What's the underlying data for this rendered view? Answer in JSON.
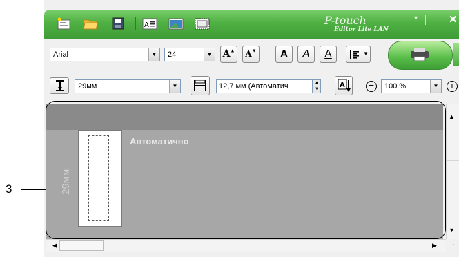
{
  "titlebar": {
    "brand_line1": "P-touch",
    "brand_line2": "Editor Lite LAN",
    "menu_arrow": "▾",
    "minimize": "–",
    "close": "✕"
  },
  "toolbar1": {
    "font_name": "Arial",
    "font_size": "24",
    "grow_font": "A",
    "shrink_font": "A",
    "bold": "A",
    "italic": "A",
    "underline": "A"
  },
  "toolbar2": {
    "tape_width": "29мм",
    "label_length": "12,7 мм (Автоматич",
    "zoom": "100 %",
    "zoom_out": "−",
    "zoom_in": "+"
  },
  "canvas": {
    "tape_label": "29мм",
    "length_text": "Автоматично"
  },
  "callout": {
    "number": "3"
  },
  "colors": {
    "titlebar_green": "#4fb043",
    "canvas_gray": "#a7a7a7"
  }
}
